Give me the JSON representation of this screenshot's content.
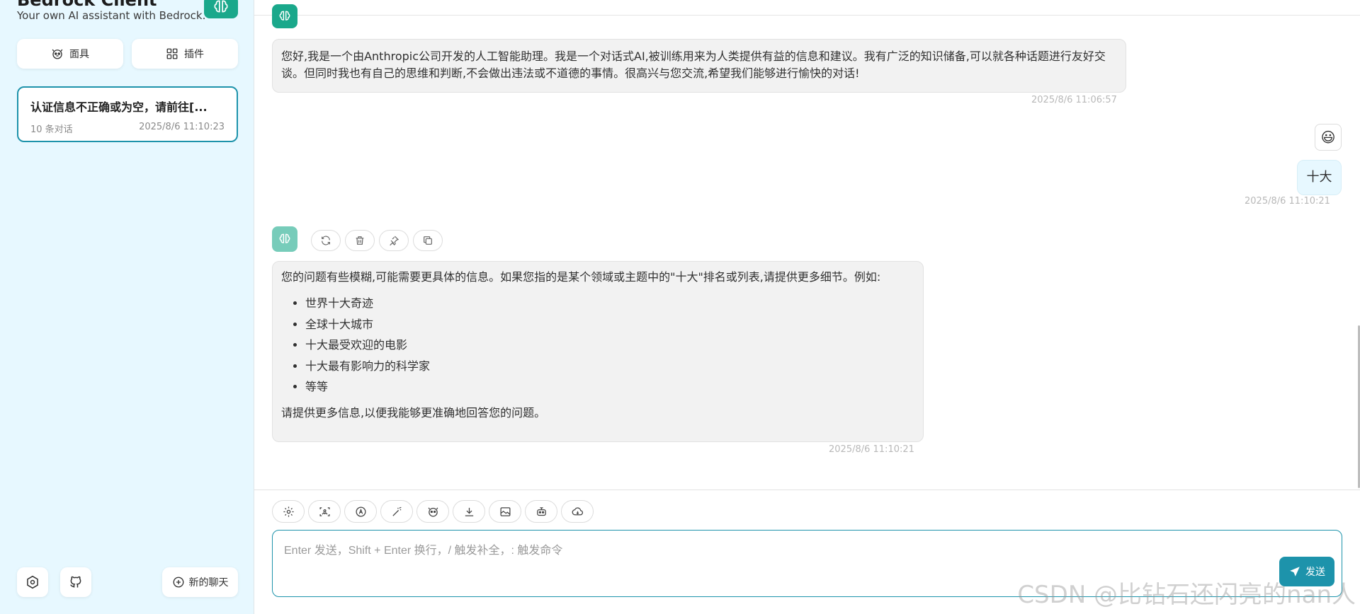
{
  "sidebar": {
    "title": "Bedrock Client",
    "subtitle": "Your own AI assistant with Bedrock.",
    "mask_label": "面具",
    "plugin_label": "插件",
    "chat_item": {
      "title": "认证信息不正确或为空，请前往[...",
      "count": "10 条对话",
      "time": "2025/8/6 11:10:23"
    },
    "new_chat_label": "新的聊天"
  },
  "messages": [
    {
      "role": "assistant",
      "text": "您好,我是一个由Anthropic公司开发的人工智能助理。我是一个对话式AI,被训练用来为人类提供有益的信息和建议。我有广泛的知识储备,可以就各种话题进行友好交谈。但同时我也有自己的思维和判断,不会做出违法或不道德的事情。很高兴与您交流,希望我们能够进行愉快的对话!",
      "time": "2025/8/6 11:06:57"
    },
    {
      "role": "user",
      "avatar": "😃",
      "text": "十大",
      "time": "2025/8/6 11:10:21"
    },
    {
      "role": "assistant",
      "intro": "您的问题有些模糊,可能需要更具体的信息。如果您指的是某个领域或主题中的\"十大\"排名或列表,请提供更多细节。例如:",
      "items": [
        "世界十大奇迹",
        "全球十大城市",
        "十大最受欢迎的电影",
        "十大最有影响力的科学家",
        "等等"
      ],
      "outro": "请提供更多信息,以便我能够更准确地回答您的问题。",
      "time": "2025/8/6 11:10:21"
    }
  ],
  "input": {
    "placeholder": "Enter 发送，Shift + Enter 换行，/ 触发补全，: 触发命令",
    "send_label": "发送"
  },
  "watermark": "CSDN @比钻石还闪亮的nan人",
  "colors": {
    "accent": "#1d93ab",
    "bot_avatar": "#1aa88b",
    "sidebar_bg": "#e7f8ff"
  }
}
